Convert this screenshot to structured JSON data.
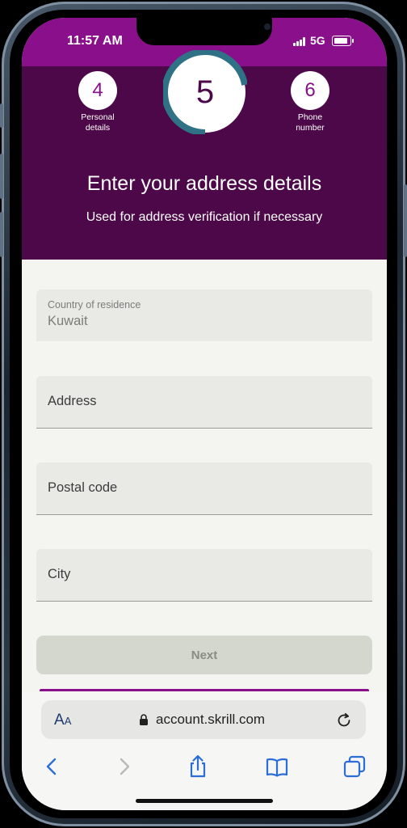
{
  "status_bar": {
    "time": "11:57 AM",
    "network": "5G",
    "battery_level": 0.9
  },
  "progress": {
    "prev_step": {
      "number": "4",
      "label_line1": "Personal",
      "label_line2": "details"
    },
    "current_step": {
      "number": "5",
      "progress_fraction": 0.72
    },
    "next_step": {
      "number": "6",
      "label_line1": "Phone",
      "label_line2": "number"
    }
  },
  "header": {
    "title": "Enter your address details",
    "subtitle": "Used for address verification if necessary"
  },
  "form": {
    "country": {
      "label": "Country of residence",
      "value": "Kuwait"
    },
    "address": {
      "placeholder": "Address"
    },
    "postal_code": {
      "placeholder": "Postal code"
    },
    "city": {
      "placeholder": "City"
    },
    "next_label": "Next"
  },
  "browser": {
    "text_size_label": "A",
    "text_size_label_small": "A",
    "url": "account.skrill.com"
  },
  "colors": {
    "brand": "#8a0f8b",
    "header_bg": "#4c0848",
    "ring": "#2f7185"
  },
  "icons": [
    "lock-icon",
    "reload-icon",
    "back-icon",
    "forward-icon",
    "share-icon",
    "bookmarks-icon",
    "tabs-icon"
  ]
}
